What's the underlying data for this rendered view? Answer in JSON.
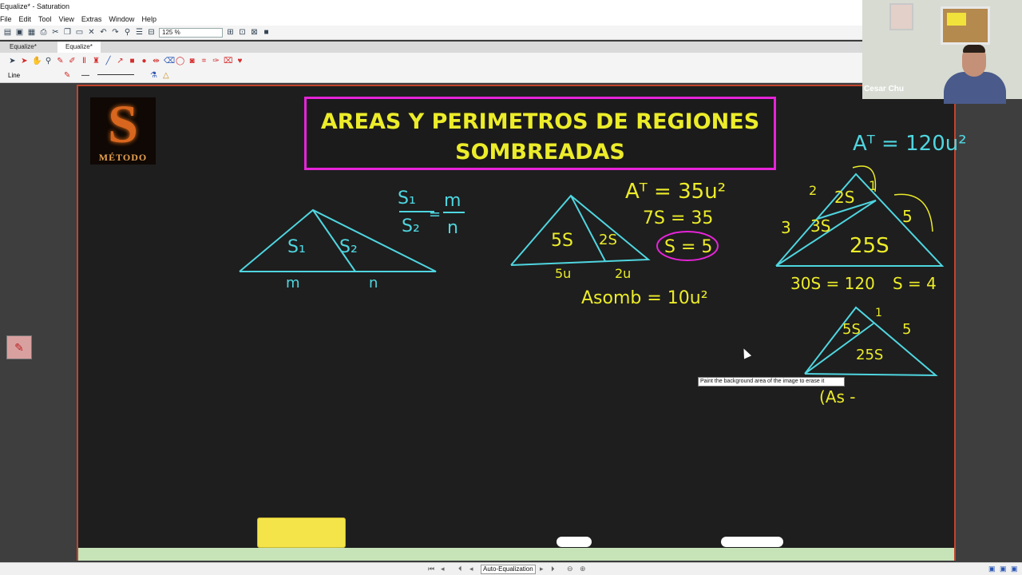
{
  "app": {
    "window_title": "Equalize* - Saturation",
    "menu": [
      "File",
      "Edit",
      "Tool",
      "View",
      "Extras",
      "Window",
      "Help"
    ],
    "zoom": "125 %",
    "tabs": [
      "Equalize*",
      "Equalize*"
    ],
    "active_tab": 1,
    "tool_label": "Line",
    "tooltip": "Paint the background area of the image to erase it",
    "status_center": "Auto-Equalization"
  },
  "webcam": {
    "name": "Cesar Chu"
  },
  "board": {
    "logo_letter": "S",
    "logo_text": "MÉTODO",
    "title_line1": "AREAS Y PERIMETROS DE REGIONES",
    "title_line2": "SOMBREADAS"
  },
  "notes": {
    "fig1": {
      "s1": "S₁",
      "s2": "S₂",
      "m": "m",
      "n": "n",
      "ratio_top": "S₁",
      "ratio_bottom": "S₂",
      "rhs_top": "m",
      "rhs_bottom": "n",
      "eq": "="
    },
    "fig2": {
      "at": "Aᵀ = 35u²",
      "seven_s": "7S = 35",
      "s_eq": "S = 5",
      "left": "5S",
      "right": "2S",
      "base_left": "5u",
      "base_right": "2u",
      "asomb": "Asomb = 10u²"
    },
    "fig3": {
      "at": "Aᵀ = 120u²",
      "top": "2S",
      "mid": "3S",
      "bottom": "25S",
      "side_2": "2",
      "side_3": "3",
      "side_1": "1",
      "side_5": "5",
      "eq1": "30S = 120",
      "eq2": "S = 4"
    },
    "fig4": {
      "top": "5S",
      "bottom": "25S",
      "side_1": "1",
      "side_5": "5",
      "partial": "(As -"
    }
  },
  "colors": {
    "chalk_cyan": "#4fd6e0",
    "chalk_yellow": "#ecec2a",
    "title_border": "#e624d8",
    "board_border": "#c2452e",
    "board_bg": "#1e1e1e"
  }
}
